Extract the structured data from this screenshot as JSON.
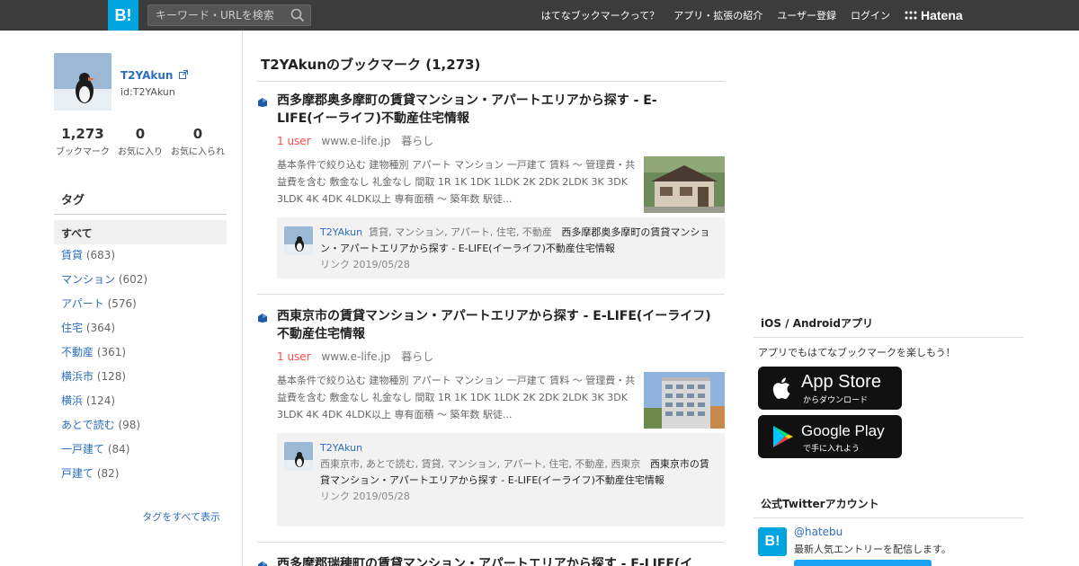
{
  "header": {
    "logo": "B!",
    "search_placeholder": "キーワード・URLを検索",
    "nav": [
      "はてなブックマークって？",
      "アプリ・拡張の紹介",
      "ユーザー登録",
      "ログイン"
    ],
    "brand": "Hatena"
  },
  "profile": {
    "display_name": "T2YAkun",
    "id": "id:T2YAkun",
    "stats": [
      {
        "value": "1,273",
        "label": "ブックマーク"
      },
      {
        "value": "0",
        "label": "お気に入り"
      },
      {
        "value": "0",
        "label": "お気に入られ"
      }
    ]
  },
  "tags": {
    "title": "タグ",
    "all_label": "すべて",
    "items": [
      {
        "name": "賃貸",
        "count": "(683)"
      },
      {
        "name": "マンション",
        "count": "(602)"
      },
      {
        "name": "アパート",
        "count": "(576)"
      },
      {
        "name": "住宅",
        "count": "(364)"
      },
      {
        "name": "不動産",
        "count": "(361)"
      },
      {
        "name": "横浜市",
        "count": "(128)"
      },
      {
        "name": "横浜",
        "count": "(124)"
      },
      {
        "name": "あとで読む",
        "count": "(98)"
      },
      {
        "name": "一戸建て",
        "count": "(84)"
      },
      {
        "name": "戸建て",
        "count": "(82)"
      }
    ],
    "show_all": "タグをすべて表示"
  },
  "main": {
    "title": "T2YAkunのブックマーク (1,273)",
    "entries": [
      {
        "title": "西多摩郡奥多摩町の賃貸マンション・アパートエリアから探す - E-LIFE(イーライフ)不動産住宅情報",
        "users": "1 user",
        "domain": "www.e-life.jp",
        "category": "暮らし",
        "summary": "基本条件で絞り込む 建物種別 アパート マンション 一戸建て 賃料 〜 管理費・共益費を含む 敷金なし 礼金なし 間取 1R 1K 1DK 1LDK 2K 2DK 2LDK 3K 3DK 3LDK 4K 4DK 4LDK以上 専有面積 〜 築年数 駅徒...",
        "comment_user": "T2YAkun",
        "comment_tags": "賃貸, マンション, アパート, 住宅, 不動産",
        "comment_text": "西多摩郡奥多摩町の賃貸マンション・アパートエリアから探す - E-LIFE(イーライフ)不動産住宅情報",
        "comment_date": "リンク 2019/05/28"
      },
      {
        "title": "西東京市の賃貸マンション・アパートエリアから探す - E-LIFE(イーライフ)不動産住宅情報",
        "users": "1 user",
        "domain": "www.e-life.jp",
        "category": "暮らし",
        "summary": "基本条件で絞り込む 建物種別 アパート マンション 一戸建て 賃料 〜 管理費・共益費を含む 敷金なし 礼金なし 間取 1R 1K 1DK 1LDK 2K 2DK 2LDK 3K 3DK 3LDK 4K 4DK 4LDK以上 専有面積 〜 築年数 駅徒...",
        "comment_user": "T2YAkun",
        "comment_tags": "西東京市, あとで読む, 賃貸, マンション, アパート, 住宅, 不動産, 西東京",
        "comment_text": "西東京市の賃貸マンション・アパートエリアから探す - E-LIFE(イーライフ)不動産住宅情報",
        "comment_date": "リンク 2019/05/28"
      },
      {
        "title": "西多摩郡瑞穂町の賃貸マンション・アパートエリアから探す - E-LIFE(イ"
      }
    ]
  },
  "sidebar_right": {
    "apps_title": "iOS / Androidアプリ",
    "apps_text": "アプリでもはてなブックマークを楽しもう！",
    "appstore_big": "App Store",
    "appstore_small": "からダウンロード",
    "googleplay_big": "Google Play",
    "googleplay_small": "で手に入れよう",
    "twitter_title": "公式Twitterアカウント",
    "twitter_handle": "@hatebu",
    "twitter_desc": "最新人気エントリーを配信します。"
  }
}
